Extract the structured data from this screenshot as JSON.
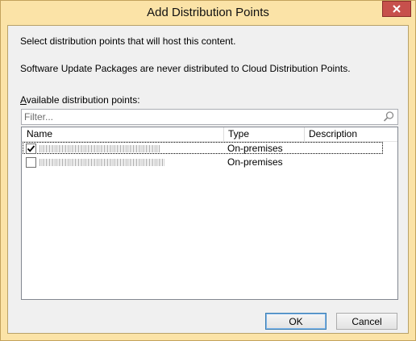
{
  "window": {
    "title": "Add Distribution Points",
    "accent_color": "#fbe3a7",
    "close_icon": "close-icon"
  },
  "content": {
    "select_message": "Select distribution points that will host this content.",
    "note": "Software Update Packages are never distributed to Cloud Distribution Points.",
    "available_label": "Available distribution points:"
  },
  "filter": {
    "placeholder": "Filter...",
    "value": "",
    "icon": "search-icon"
  },
  "list": {
    "columns": [
      {
        "label": "Name"
      },
      {
        "label": "Type"
      },
      {
        "label": "Description"
      }
    ],
    "rows": [
      {
        "name": "",
        "type": "On-premises",
        "description": "",
        "checked": true,
        "selected": true
      },
      {
        "name": "",
        "type": "On-premises",
        "description": "",
        "checked": false,
        "selected": false
      }
    ]
  },
  "buttons": {
    "ok": "OK",
    "cancel": "Cancel"
  }
}
